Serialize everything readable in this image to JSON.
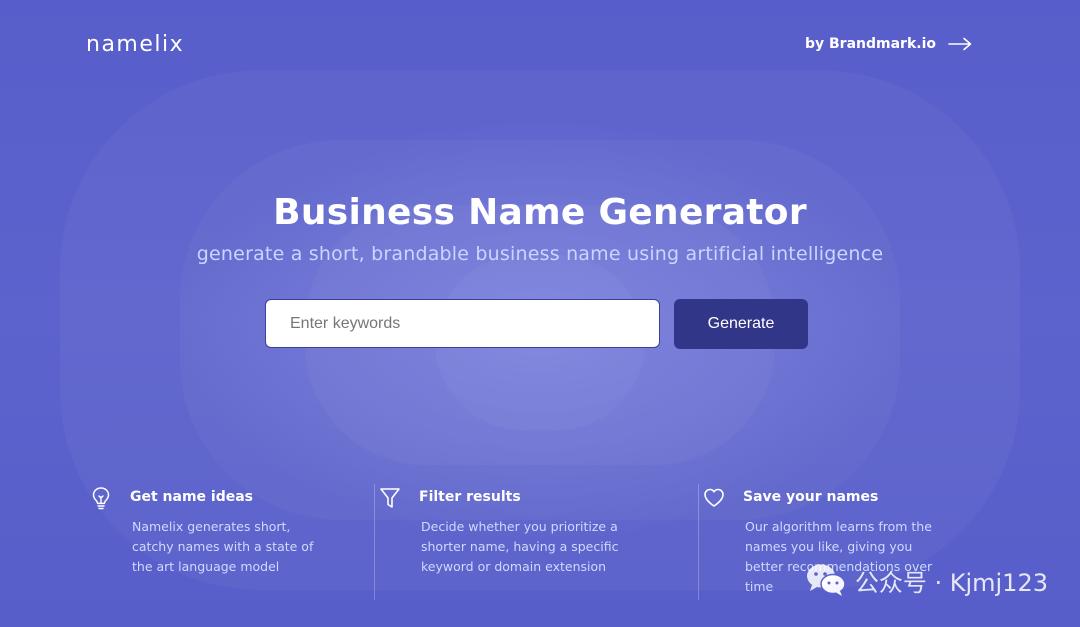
{
  "header": {
    "logo": "namelix",
    "brand_link": "by Brandmark.io"
  },
  "hero": {
    "title": "Business Name Generator",
    "subtitle": "generate a short, brandable business name using artificial intelligence"
  },
  "search": {
    "placeholder": "Enter keywords",
    "value": "",
    "button_label": "Generate"
  },
  "features": [
    {
      "icon": "lightbulb-icon",
      "title": "Get name ideas",
      "description": "Namelix generates short, catchy names with a state of the art language model"
    },
    {
      "icon": "filter-icon",
      "title": "Filter results",
      "description": "Decide whether you prioritize a shorter name, having a specific keyword or domain extension"
    },
    {
      "icon": "heart-icon",
      "title": "Save your names",
      "description": "Our algorithm learns from the names you like, giving you better recommendations over time"
    }
  ],
  "watermark": {
    "text": "公众号 · Kjmj123"
  },
  "colors": {
    "background": "#5a60cc",
    "button": "#323688",
    "subtitle": "#c9d6ff"
  }
}
